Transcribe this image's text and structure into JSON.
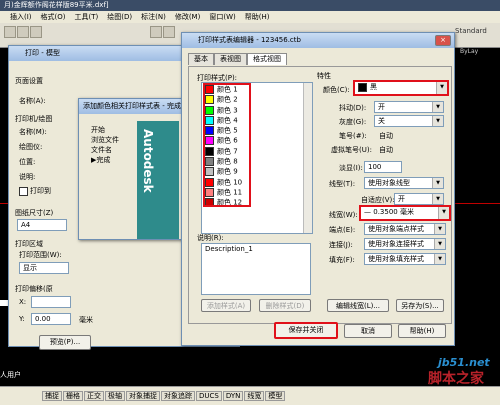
{
  "cad": {
    "title": "月)金辉额作阁花样版89平米.dxf]",
    "menu": [
      "插入(I)",
      "格式(O)",
      "工具(T)",
      "绘图(D)",
      "标注(N)",
      "修改(M)",
      "窗口(W)",
      "帮助(H)"
    ],
    "right_label": "Standard",
    "bylayer": "ByLay",
    "status_items": [
      "捕捉",
      "栅格",
      "正交",
      "极轴",
      "对象捕捉",
      "对象追踪",
      "DUCS",
      "DYN",
      "线宽",
      "模型"
    ],
    "cmd_fragment": "人用户"
  },
  "print_dialog": {
    "title": "打印 - 模型",
    "page_setup": "页面设置",
    "name_label": "名称(A):",
    "printer_label": "打印机/绘图",
    "printer_name": "名称(M):",
    "plotter_label": "绘图仪:",
    "location_label": "位置:",
    "desc_label": "说明:",
    "print_to_file": "打印到",
    "paper_label": "图纸尺寸(Z)",
    "paper_value": "A4",
    "area_label": "打印区域",
    "range_label": "打印范围(W):",
    "range_value": "显示",
    "offset_label": "打印偏移(原",
    "x_label": "X:",
    "y_label": "Y:",
    "y_value": "0.00",
    "unit_mm": "毫米",
    "preview_button": "预览(P)..."
  },
  "wizard": {
    "title": "添加颜色相关打印样式表 - 完成",
    "steps": [
      "开始",
      "浏览文件",
      "文件名",
      "完成"
    ],
    "banner_text": "Autodesk"
  },
  "editor": {
    "title": "打印样式表编辑器 - 123456.ctb",
    "tabs": [
      "基本",
      "表视图",
      "格式视图"
    ],
    "styles_label": "打印样式(P):",
    "styles": [
      {
        "name": "颜色 1",
        "color": "#ff0000"
      },
      {
        "name": "颜色 2",
        "color": "#ffff00"
      },
      {
        "name": "颜色 3",
        "color": "#00ff00"
      },
      {
        "name": "颜色 4",
        "color": "#00ffff"
      },
      {
        "name": "颜色 5",
        "color": "#0000ff"
      },
      {
        "name": "颜色 6",
        "color": "#ff00ff"
      },
      {
        "name": "颜色 7",
        "color": "#000000"
      },
      {
        "name": "颜色 8",
        "color": "#808080"
      },
      {
        "name": "颜色 9",
        "color": "#c0c0c0"
      },
      {
        "name": "颜色 10",
        "color": "#ff0000"
      },
      {
        "name": "颜色 11",
        "color": "#ff7f7f"
      },
      {
        "name": "颜色 12",
        "color": "#cc0000"
      }
    ],
    "desc_label": "说明(R):",
    "desc_value": "Description_1",
    "add_style": "添加样式(A)",
    "delete_style": "删除样式(D)",
    "props_title": "特性",
    "props": {
      "color": {
        "label": "颜色(C):",
        "value": "黑",
        "swatch": "#000000"
      },
      "dither": {
        "label": "抖动(D):",
        "value": "开"
      },
      "grayscale": {
        "label": "灰度(G):",
        "value": "关"
      },
      "pen": {
        "label": "笔号(#):",
        "value": "自动"
      },
      "virtual_pen": {
        "label": "虚拟笔号(U):",
        "value": "自动"
      },
      "screening": {
        "label": "淡显(I):",
        "value": "100"
      },
      "linetype": {
        "label": "线型(T):",
        "value": "使用对象线型"
      },
      "adaptive": {
        "label": "自适应(V):",
        "value": "开"
      },
      "lineweight": {
        "label": "线宽(W):",
        "value": "0.3500 毫米"
      },
      "endstyle": {
        "label": "端点(E):",
        "value": "使用对象端点样式"
      },
      "joinstyle": {
        "label": "连接(J):",
        "value": "使用对象连接样式"
      },
      "fillstyle": {
        "label": "填充(F):",
        "value": "使用对象填充样式"
      }
    },
    "edit_lineweights": "编辑线宽(L)...",
    "save_as": "另存为(S)...",
    "save_close": "保存并关闭",
    "cancel": "取消",
    "help": "帮助(H)"
  },
  "watermark": {
    "site": "jb51.net",
    "brand": "脚本之家"
  }
}
